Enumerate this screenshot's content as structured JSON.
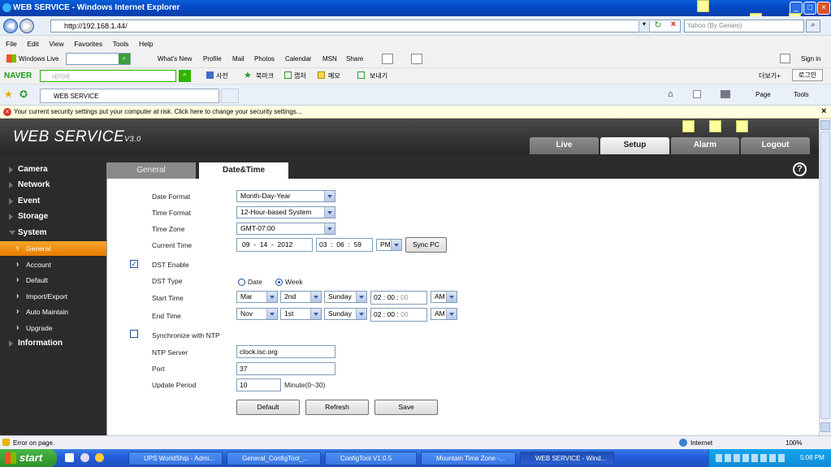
{
  "window": {
    "title": "WEB SERVICE - Windows Internet Explorer"
  },
  "address": {
    "url": "http://192.168.1.44/",
    "search_placeholder": "Yahoo (By Genieo)"
  },
  "menubar": [
    "File",
    "Edit",
    "View",
    "Favorites",
    "Tools",
    "Help"
  ],
  "windows_live": {
    "label": "Windows Live",
    "items": [
      "What's New",
      "Profile",
      "Mail",
      "Photos",
      "Calendar",
      "MSN",
      "Share"
    ],
    "sign_in": "Sign in"
  },
  "naver": {
    "brand": "NAVER",
    "search_placeholder": "네이버",
    "dict": "사전",
    "bookmark": "북마크",
    "capture": "캡처",
    "memo": "메모",
    "send": "보내기",
    "more": "더보기+",
    "login": "로그인"
  },
  "favbar": {
    "tab": "WEB SERVICE",
    "page": "Page",
    "tools": "Tools"
  },
  "security_bar": {
    "text": "Your current security settings put your computer at risk. Click here to change your security settings..."
  },
  "app": {
    "logo": "WEB  SERVICE",
    "version": "V3.0",
    "top_tabs": [
      "Live",
      "Setup",
      "Alarm",
      "Logout"
    ],
    "sidebar": [
      "Camera",
      "Network",
      "Event",
      "Storage",
      "System",
      "Information"
    ],
    "system_sub": [
      "General",
      "Account",
      "Default",
      "Import/Export",
      "Auto Maintain",
      "Upgrade"
    ],
    "page_tabs": [
      "General",
      "Date&Time"
    ],
    "help": "?"
  },
  "form": {
    "date_format_label": "Date Format",
    "date_format": "Month-Day-Year",
    "time_format_label": "Time Format",
    "time_format": "12-Hour-based System",
    "time_zone_label": "Time Zone",
    "time_zone": "GMT-07:00",
    "current_time_label": "Current Time",
    "date_mm": "09",
    "date_dd": "14",
    "date_yyyy": "2012",
    "time_hh": "03",
    "time_mm": "06",
    "time_ss": "59",
    "ampm": "PM",
    "sync_pc": "Sync PC",
    "dst_enable_label": "DST Enable",
    "dst_type_label": "DST Type",
    "dst_date": "Date",
    "dst_week": "Week",
    "start_time_label": "Start Time",
    "start_month": "Mar",
    "start_week": "2nd",
    "start_day": "Sunday",
    "start_hh": "02",
    "start_mm": "00",
    "start_ss": "00",
    "start_ampm": "AM",
    "end_time_label": "End Time",
    "end_month": "Nov",
    "end_week": "1st",
    "end_day": "Sunday",
    "end_hh": "02",
    "end_mm": "00",
    "end_ss": "00",
    "end_ampm": "AM",
    "ntp_label": "Synchronize with NTP",
    "ntp_server_label": "NTP Server",
    "ntp_server": "clock.isc.org",
    "port_label": "Port",
    "port": "37",
    "update_period_label": "Update Period",
    "update_period": "10",
    "update_unit": "Minute(0~30)",
    "default_btn": "Default",
    "refresh_btn": "Refresh",
    "save_btn": "Save"
  },
  "statusbar": {
    "left": "Error on page.",
    "zone": "Internet",
    "zoom": "100%"
  },
  "taskbar": {
    "start": "start",
    "tasks": [
      "UPS WorldShip - Admi...",
      "General_ConfigTool_...",
      "ConfigTool V1.0.5",
      "Mountain Time Zone -...",
      "WEB SERVICE - Wind..."
    ],
    "clock": "5:08 PM"
  }
}
